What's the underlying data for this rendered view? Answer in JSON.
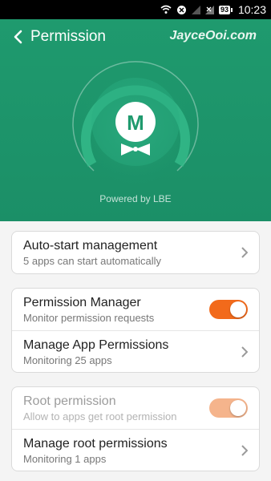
{
  "status_bar": {
    "battery": "93",
    "time": "10:23",
    "icons": [
      "wifi-icon",
      "sync-blocked-icon",
      "signal-icon",
      "no-signal-icon",
      "battery-icon"
    ]
  },
  "header": {
    "title": "Permission",
    "watermark": "JayceOoi.com",
    "logo_letter": "M",
    "powered_by": "Powered by LBE",
    "color": "#1f9a6e"
  },
  "cards": {
    "autostart": {
      "title": "Auto-start management",
      "subtitle": "5 apps can start automatically"
    },
    "permission": {
      "manager_title": "Permission Manager",
      "manager_sub": "Monitor permission requests",
      "manager_toggle_on": true,
      "apps_title": "Manage App Permissions",
      "apps_sub": "Monitoring 25 apps"
    },
    "root": {
      "root_title": "Root permission",
      "root_sub": "Allow to apps get root permission",
      "root_toggle_on": true,
      "root_enabled": false,
      "manage_title": "Manage root permissions",
      "manage_sub": "Monitoring 1 apps"
    }
  },
  "colors": {
    "accent": "#f26a1b",
    "accent_disabled": "#f5b48c",
    "header_green": "#1f9a6e"
  }
}
